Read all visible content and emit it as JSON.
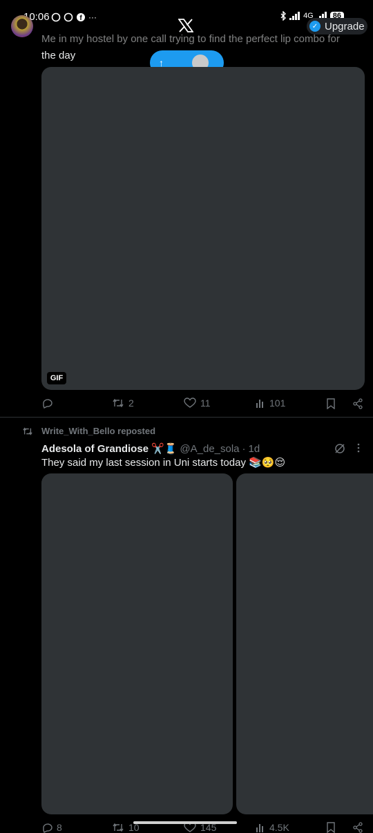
{
  "status_bar": {
    "time": "10:06",
    "network": "4G",
    "battery": "86"
  },
  "header": {
    "upgrade_label": "Upgrade"
  },
  "new_posts_pill": {
    "arrow": "↑"
  },
  "tweet1": {
    "faded_text": "Me in my hostel by one call trying to find the perfect lip combo for",
    "text_line2": "the day",
    "gif_label": "GIF",
    "replies": "",
    "reposts": "2",
    "likes": "11",
    "views": "101"
  },
  "tweet2": {
    "repost_label": "Write_With_Bello reposted",
    "author_name": "Adesola of Grandiose",
    "author_emoji": "✂️🧵",
    "handle": "@A_de_sola",
    "separator": "·",
    "time": "1d",
    "text": "They said my last session in Uni starts today 📚🥺😌",
    "replies": "8",
    "reposts": "10",
    "likes": "145",
    "views": "4.5K"
  }
}
